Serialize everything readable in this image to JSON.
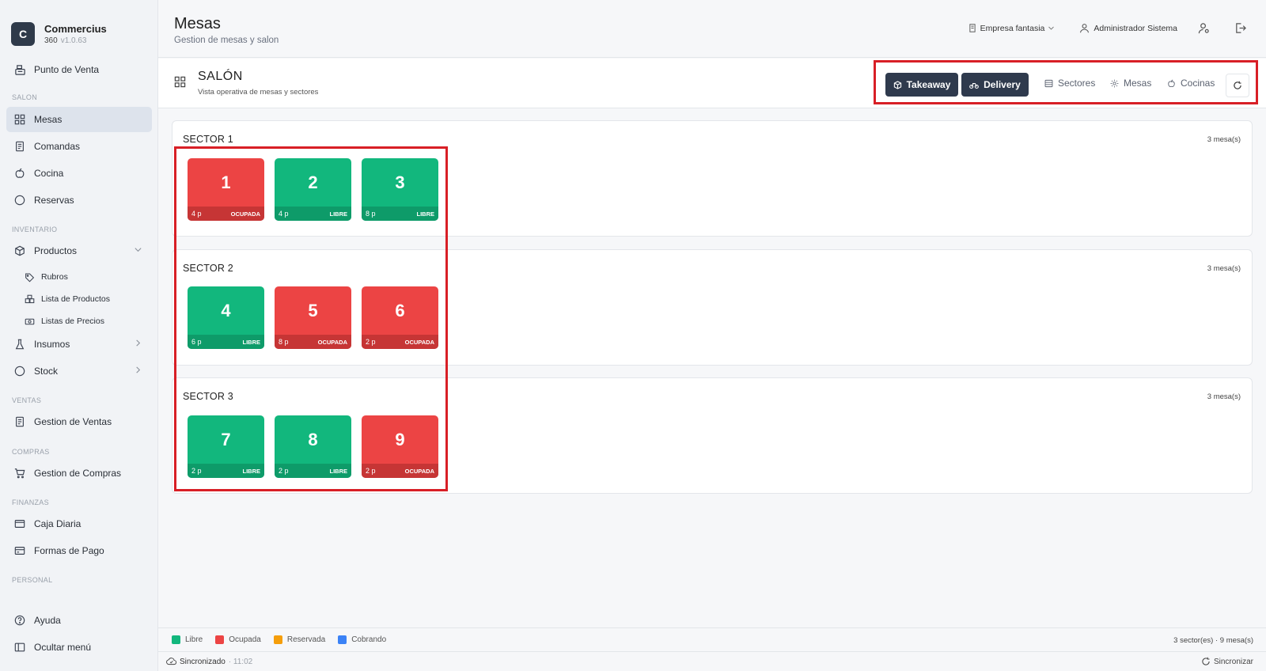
{
  "brand": {
    "initial": "C",
    "name": "Commercius",
    "sub": "360",
    "version": "v1.0.63"
  },
  "sidebar": {
    "punto_venta": "Punto de Venta",
    "sections": {
      "salon": "SALON",
      "inventario": "INVENTARIO",
      "ventas": "VENTAS",
      "compras": "COMPRAS",
      "finanzas": "FINANZAS",
      "personal": "PERSONAL"
    },
    "items": {
      "mesas": "Mesas",
      "comandas": "Comandas",
      "cocina": "Cocina",
      "reservas": "Reservas",
      "productos": "Productos",
      "rubros": "Rubros",
      "lista_productos": "Lista de Productos",
      "listas_precios": "Listas de Precios",
      "insumos": "Insumos",
      "stock": "Stock",
      "gestion_ventas": "Gestion de Ventas",
      "gestion_compras": "Gestion de Compras",
      "caja_diaria": "Caja Diaria",
      "formas_pago": "Formas de Pago",
      "ayuda": "Ayuda",
      "ocultar_menu": "Ocultar menú"
    }
  },
  "header": {
    "title": "Mesas",
    "subtitle": "Gestion de mesas y salon",
    "empresa": "Empresa fantasia",
    "user": "Administrador Sistema"
  },
  "salon": {
    "title": "SALÓN",
    "subtitle": "Vista operativa de mesas y sectores",
    "buttons": {
      "takeaway": "Takeaway",
      "delivery": "Delivery",
      "sectores": "Sectores",
      "mesas": "Mesas",
      "cocinas": "Cocinas"
    }
  },
  "sectors": [
    {
      "name": "SECTOR 1",
      "count": "3  mesa(s)",
      "tables": [
        {
          "num": "1",
          "cap": "4 p",
          "status": "OCUPADA"
        },
        {
          "num": "2",
          "cap": "4 p",
          "status": "LIBRE"
        },
        {
          "num": "3",
          "cap": "8 p",
          "status": "LIBRE"
        }
      ]
    },
    {
      "name": "SECTOR 2",
      "count": "3  mesa(s)",
      "tables": [
        {
          "num": "4",
          "cap": "6 p",
          "status": "LIBRE"
        },
        {
          "num": "5",
          "cap": "8 p",
          "status": "OCUPADA"
        },
        {
          "num": "6",
          "cap": "2 p",
          "status": "OCUPADA"
        }
      ]
    },
    {
      "name": "SECTOR 3",
      "count": "3  mesa(s)",
      "tables": [
        {
          "num": "7",
          "cap": "2 p",
          "status": "LIBRE"
        },
        {
          "num": "8",
          "cap": "2 p",
          "status": "LIBRE"
        },
        {
          "num": "9",
          "cap": "2 p",
          "status": "OCUPADA"
        }
      ]
    }
  ],
  "legend": {
    "libre": "Libre",
    "ocupada": "Ocupada",
    "reservada": "Reservada",
    "cobrando": "Cobrando",
    "summary": "3 sector(es) · 9 mesa(s)",
    "colors": {
      "libre": "#12b77d",
      "ocupada": "#ec4444",
      "reservada": "#f59e0b",
      "cobrando": "#3b82f6"
    }
  },
  "status": {
    "sync": "Sincronizado",
    "time": "· 11:02",
    "sync_button": "Sincronizar"
  }
}
